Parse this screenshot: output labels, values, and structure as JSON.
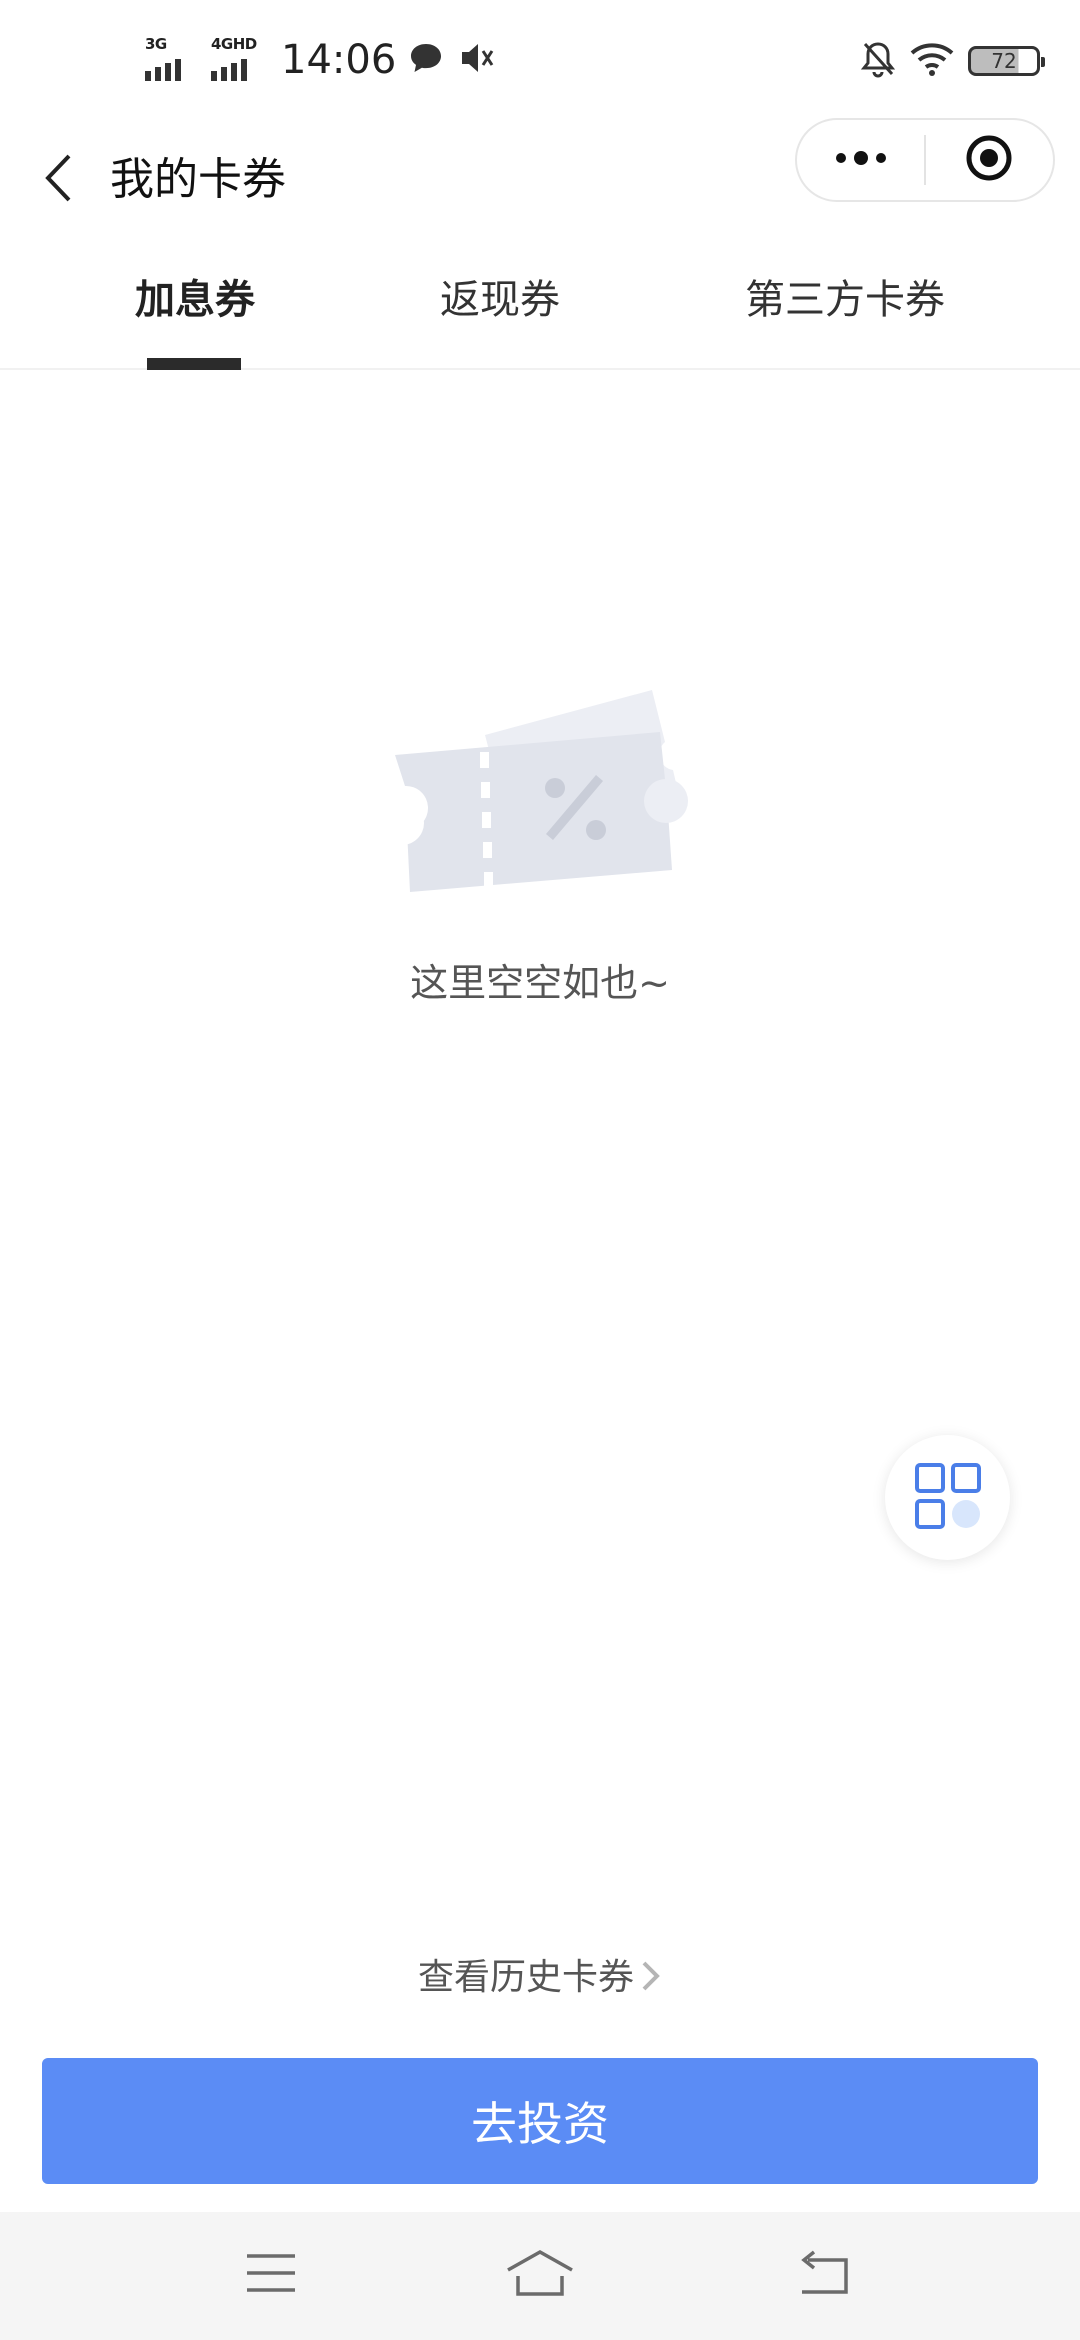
{
  "status_bar": {
    "network1": "3G",
    "network2": "4GHD",
    "time": "14:06",
    "battery": "72",
    "icons": [
      "chat-bubble-icon",
      "speaker-mute-icon",
      "bell-off-icon",
      "wifi-icon",
      "battery-icon"
    ]
  },
  "header": {
    "title": "我的卡券",
    "back_icon": "chevron-left-icon",
    "capsule_icons": [
      "more-dots-icon",
      "target-icon"
    ]
  },
  "tabs": [
    {
      "label": "加息券",
      "active": true
    },
    {
      "label": "返现券",
      "active": false
    },
    {
      "label": "第三方卡券",
      "active": false
    }
  ],
  "empty_state": {
    "text": "这里空空如也~",
    "icon": "coupon-ticket-icon"
  },
  "float_button": {
    "icon": "grid-apps-icon"
  },
  "history_link": {
    "label": "查看历史卡券",
    "chevron": "›"
  },
  "primary_button": {
    "label": "去投资",
    "color": "#5b8cf5"
  },
  "nav_bar": {
    "icons": [
      "menu-icon",
      "home-icon",
      "back-icon"
    ]
  }
}
